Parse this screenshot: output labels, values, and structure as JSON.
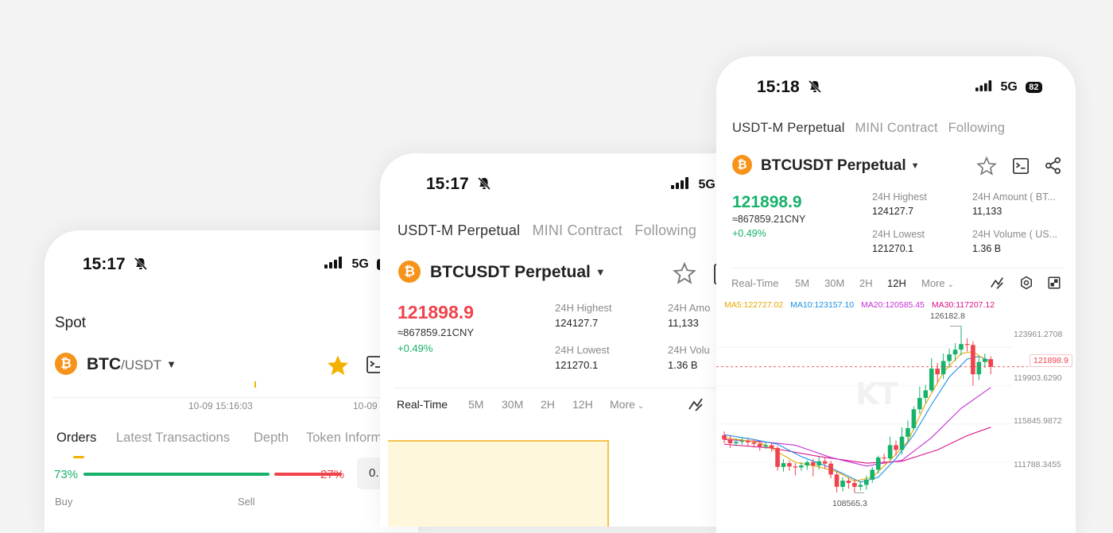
{
  "phone_spot": {
    "status": {
      "time": "15:17",
      "network": "5G"
    },
    "section_title": "Spot",
    "pair_base": "BTC",
    "pair_quote": "/USDT",
    "time_label_1": "10-09 15:16:03",
    "time_label_2": "10-09",
    "tabs": [
      "Orders",
      "Latest Transactions",
      "Depth",
      "Token Inform"
    ],
    "buy_pct": "73%",
    "sell_pct": "27%",
    "buy_ratio": 0.73,
    "side_value": "0.",
    "buy_label": "Buy",
    "sell_label": "Sell"
  },
  "phone_contract_mid": {
    "status": {
      "time": "15:17",
      "network": "5G"
    },
    "tabs": [
      "USDT-M Perpetual",
      "MINI Contract",
      "Following"
    ],
    "pair": "BTCUSDT Perpetual",
    "price": "121898.9",
    "cny": "≈867859.21CNY",
    "change": "+0.49%",
    "stats": {
      "high_label": "24H Highest",
      "high_value": "124127.7",
      "low_label": "24H Lowest",
      "low_value": "121270.1",
      "amount_label": "24H Amo",
      "amount_value": "11,133",
      "volume_label": "24H Volu",
      "volume_value": "1.36 B"
    },
    "timeframes": [
      "Real-Time",
      "5M",
      "30M",
      "2H",
      "12H",
      "More"
    ]
  },
  "phone_contract_front": {
    "status": {
      "time": "15:18",
      "network": "5G",
      "battery": "82"
    },
    "tabs": [
      "USDT-M Perpetual",
      "MINI Contract",
      "Following"
    ],
    "pair": "BTCUSDT Perpetual",
    "price": "121898.9",
    "cny": "≈867859.21CNY",
    "change": "+0.49%",
    "stats": {
      "high_label": "24H Highest",
      "high_value": "124127.7",
      "low_label": "24H Lowest",
      "low_value": "121270.1",
      "amount_label": "24H Amount ( BT...",
      "amount_value": "11,133",
      "volume_label": "24H Volume ( US...",
      "volume_value": "1.36 B"
    },
    "timeframes": [
      "Real-Time",
      "5M",
      "30M",
      "2H",
      "12H",
      "More"
    ],
    "ma": {
      "ma5": "MA5:122727.02",
      "ma10": "MA10:123157.10",
      "ma20": "MA20:120585.45",
      "ma30": "MA30:117207.12"
    },
    "colors": {
      "ma5": "#e6a700",
      "ma10": "#1a8fe3",
      "ma20": "#c62fd4",
      "ma30": "#d8138a",
      "up": "#17b26a",
      "down": "#f0434c"
    }
  },
  "chart_data": {
    "type": "candlestick",
    "y_ticks": [
      "123961.2708",
      "119903.6290",
      "115845.9872",
      "111788.3455"
    ],
    "current_price_tag": "121898.9",
    "high_annotation": "126182.8",
    "low_annotation": "108565.3",
    "ylim": [
      107000,
      127500
    ],
    "candles": [
      {
        "o": 114650,
        "c": 114200,
        "h": 115050,
        "l": 113800
      },
      {
        "o": 114200,
        "c": 113800,
        "h": 114650,
        "l": 113300
      },
      {
        "o": 113800,
        "c": 113950,
        "h": 114300,
        "l": 113500
      },
      {
        "o": 113950,
        "c": 114050,
        "h": 114350,
        "l": 113650
      },
      {
        "o": 114050,
        "c": 113900,
        "h": 114400,
        "l": 113500
      },
      {
        "o": 113900,
        "c": 113750,
        "h": 114250,
        "l": 113350
      },
      {
        "o": 113750,
        "c": 113450,
        "h": 114000,
        "l": 113000
      },
      {
        "o": 113450,
        "c": 113600,
        "h": 113900,
        "l": 113200
      },
      {
        "o": 113600,
        "c": 113300,
        "h": 113850,
        "l": 112900
      },
      {
        "o": 113300,
        "c": 111300,
        "h": 113500,
        "l": 110900
      },
      {
        "o": 111300,
        "c": 111700,
        "h": 112100,
        "l": 110800
      },
      {
        "o": 111700,
        "c": 111350,
        "h": 112000,
        "l": 110900
      },
      {
        "o": 111350,
        "c": 111250,
        "h": 111700,
        "l": 110400
      },
      {
        "o": 111250,
        "c": 111450,
        "h": 111800,
        "l": 110900
      },
      {
        "o": 111450,
        "c": 111800,
        "h": 112000,
        "l": 111000
      },
      {
        "o": 111800,
        "c": 111450,
        "h": 112150,
        "l": 110300
      },
      {
        "o": 111450,
        "c": 111900,
        "h": 112400,
        "l": 111000
      },
      {
        "o": 111900,
        "c": 111650,
        "h": 112300,
        "l": 111100
      },
      {
        "o": 111650,
        "c": 110500,
        "h": 111950,
        "l": 110100
      },
      {
        "o": 110500,
        "c": 109200,
        "h": 110800,
        "l": 108600
      },
      {
        "o": 109200,
        "c": 109850,
        "h": 110200,
        "l": 108700
      },
      {
        "o": 109850,
        "c": 109600,
        "h": 110150,
        "l": 109000
      },
      {
        "o": 109600,
        "c": 109200,
        "h": 110000,
        "l": 108565
      },
      {
        "o": 109200,
        "c": 109400,
        "h": 109800,
        "l": 108800
      },
      {
        "o": 109400,
        "c": 109950,
        "h": 110400,
        "l": 108900
      },
      {
        "o": 109950,
        "c": 111000,
        "h": 111300,
        "l": 109600
      },
      {
        "o": 111000,
        "c": 112300,
        "h": 112500,
        "l": 110600
      },
      {
        "o": 112300,
        "c": 112200,
        "h": 112700,
        "l": 111800
      },
      {
        "o": 112200,
        "c": 113600,
        "h": 114500,
        "l": 112000
      },
      {
        "o": 113600,
        "c": 113100,
        "h": 114100,
        "l": 112500
      },
      {
        "o": 113100,
        "c": 114500,
        "h": 115500,
        "l": 112600
      },
      {
        "o": 114500,
        "c": 115400,
        "h": 116200,
        "l": 114000
      },
      {
        "o": 115400,
        "c": 117400,
        "h": 117700,
        "l": 115200
      },
      {
        "o": 117400,
        "c": 118600,
        "h": 119800,
        "l": 116900
      },
      {
        "o": 118600,
        "c": 119400,
        "h": 120000,
        "l": 118000
      },
      {
        "o": 119400,
        "c": 121700,
        "h": 122800,
        "l": 119200
      },
      {
        "o": 121700,
        "c": 121100,
        "h": 122300,
        "l": 120200
      },
      {
        "o": 121100,
        "c": 122500,
        "h": 123300,
        "l": 120600
      },
      {
        "o": 122500,
        "c": 123200,
        "h": 123800,
        "l": 121800
      },
      {
        "o": 123200,
        "c": 123700,
        "h": 124400,
        "l": 122500
      },
      {
        "o": 123700,
        "c": 124300,
        "h": 126182.8,
        "l": 123100
      },
      {
        "o": 124300,
        "c": 124200,
        "h": 124900,
        "l": 123500
      },
      {
        "o": 124200,
        "c": 121100,
        "h": 124600,
        "l": 119900
      },
      {
        "o": 121100,
        "c": 122400,
        "h": 123000,
        "l": 120500
      },
      {
        "o": 122400,
        "c": 122700,
        "h": 123300,
        "l": 121800
      },
      {
        "o": 122700,
        "c": 121900,
        "h": 123000,
        "l": 121100
      }
    ],
    "ma5": [
      [
        0,
        114400
      ],
      [
        6,
        113900
      ],
      [
        9,
        112900
      ],
      [
        12,
        111800
      ],
      [
        16,
        111300
      ],
      [
        19,
        110800
      ],
      [
        22,
        109800
      ],
      [
        25,
        110200
      ],
      [
        28,
        112000
      ],
      [
        31,
        114000
      ],
      [
        34,
        118000
      ],
      [
        37,
        121300
      ],
      [
        40,
        123300
      ],
      [
        42,
        123500
      ],
      [
        45,
        122200
      ]
    ],
    "ma10": [
      [
        0,
        114700
      ],
      [
        5,
        114200
      ],
      [
        9,
        113700
      ],
      [
        13,
        112400
      ],
      [
        18,
        111200
      ],
      [
        23,
        109700
      ],
      [
        26,
        110200
      ],
      [
        29,
        112200
      ],
      [
        32,
        114700
      ],
      [
        35,
        117900
      ],
      [
        38,
        120800
      ],
      [
        41,
        122700
      ],
      [
        43,
        123000
      ],
      [
        45,
        122500
      ]
    ],
    "ma20": [
      [
        0,
        114200
      ],
      [
        6,
        114000
      ],
      [
        12,
        113600
      ],
      [
        18,
        112300
      ],
      [
        24,
        111400
      ],
      [
        30,
        112000
      ],
      [
        35,
        114400
      ],
      [
        40,
        117500
      ],
      [
        45,
        119700
      ]
    ],
    "ma30": [
      [
        0,
        113700
      ],
      [
        8,
        113300
      ],
      [
        16,
        112400
      ],
      [
        24,
        111700
      ],
      [
        30,
        111900
      ],
      [
        36,
        113100
      ],
      [
        41,
        114600
      ],
      [
        45,
        115500
      ]
    ]
  }
}
